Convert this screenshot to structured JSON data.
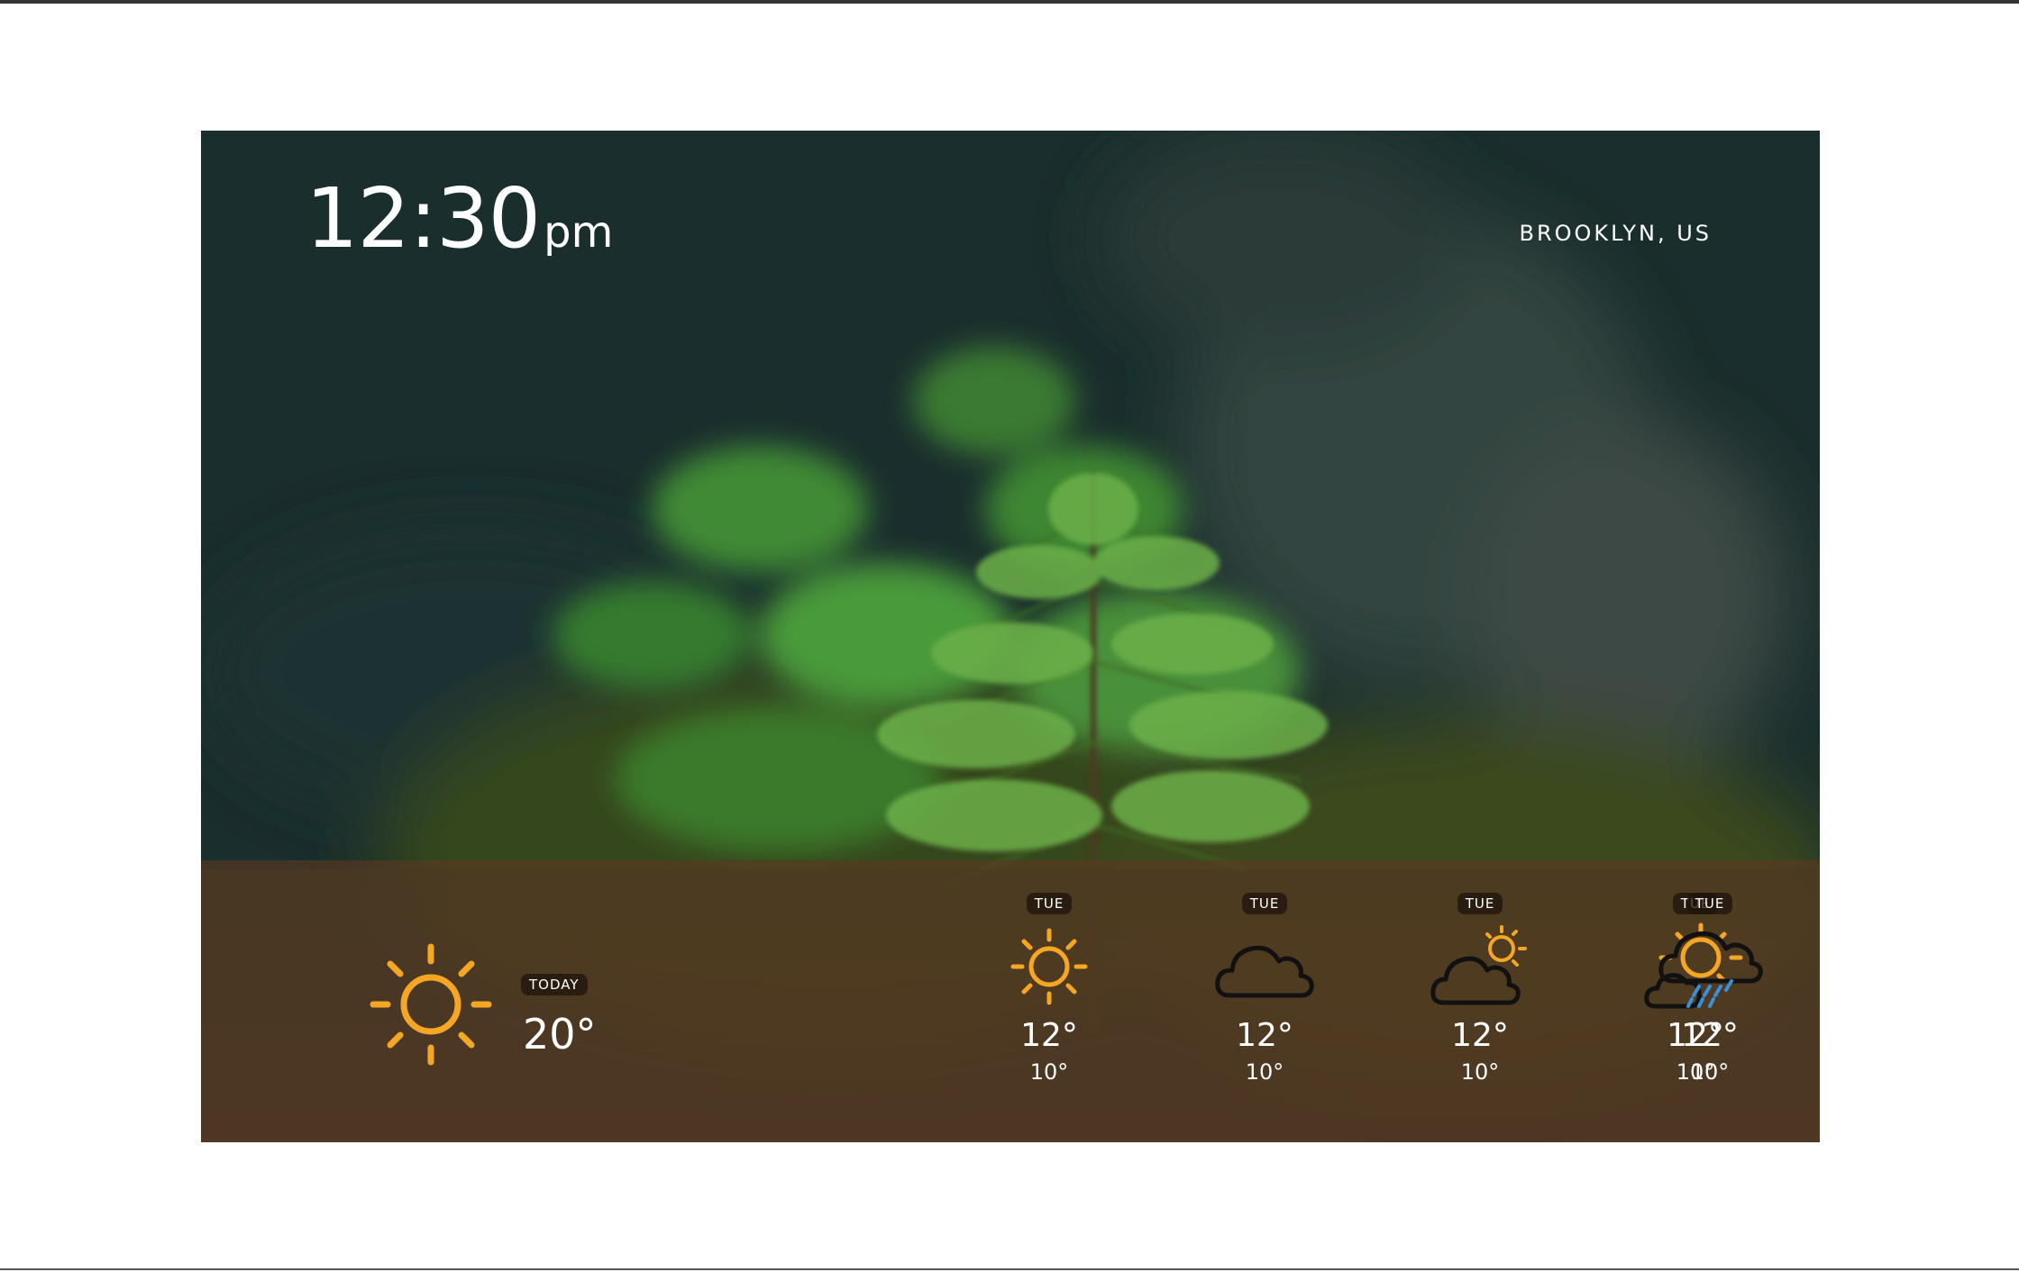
{
  "clock": {
    "time": "12:30",
    "ampm": "pm"
  },
  "location": "BROOKLYN, US",
  "colors": {
    "sun": "#f5a623",
    "cloud_stroke": "#111111",
    "rain": "#3b8fd6",
    "forecast_bar": "#5c3822",
    "background_dark": "#1b2f2f"
  },
  "today": {
    "label": "TODAY",
    "temp": "20°",
    "icon": "sun-icon"
  },
  "forecast": [
    {
      "day": "TUE",
      "high": "12°",
      "low": "10°",
      "icon": "sun-icon"
    },
    {
      "day": "TUE",
      "high": "12°",
      "low": "10°",
      "icon": "cloud-icon"
    },
    {
      "day": "TUE",
      "high": "12°",
      "low": "10°",
      "icon": "cloud-sun-icon"
    },
    {
      "day": "TUE",
      "high": "12°",
      "low": "10°",
      "icon": "sun-cloud-icon"
    },
    {
      "day": "TUE",
      "high": "12°",
      "low": "10°",
      "icon": "rain-cloud-icon"
    }
  ]
}
